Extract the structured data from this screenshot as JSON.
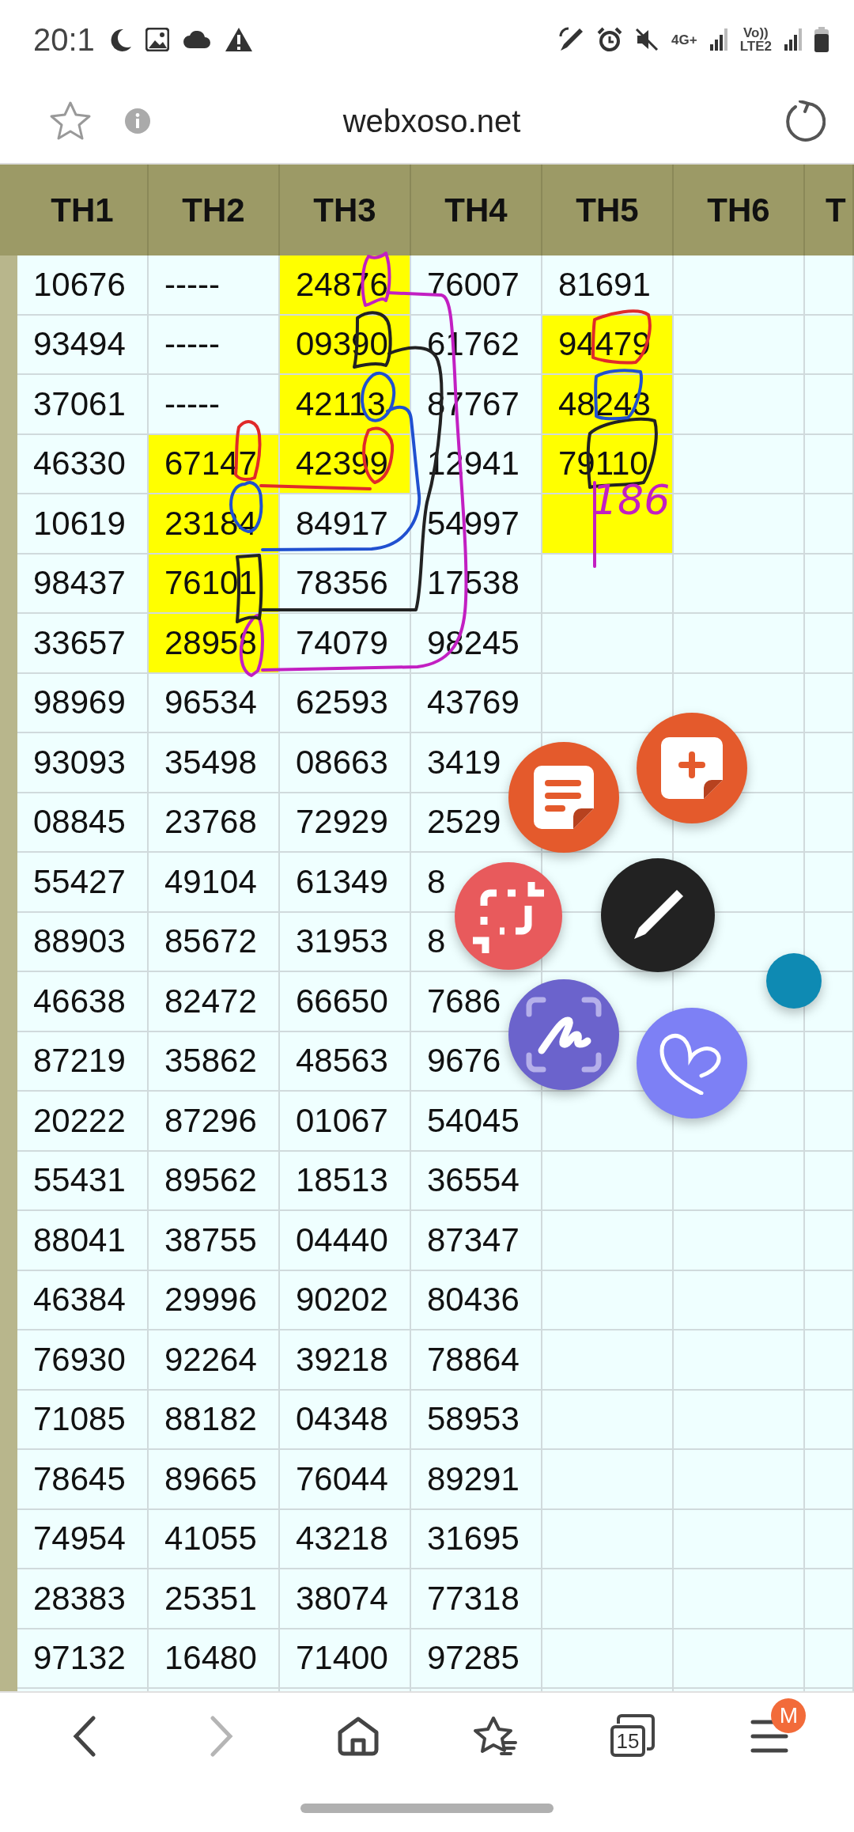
{
  "status_bar": {
    "time": "20:1",
    "network": "4G+",
    "volte": "Vo))",
    "lte": "LTE2"
  },
  "address_bar": {
    "url": "webxoso.net"
  },
  "table": {
    "columns": [
      "TH1",
      "TH2",
      "TH3",
      "TH4",
      "TH5",
      "TH6",
      "T"
    ],
    "rows": [
      {
        "cells": [
          "10676",
          "-----",
          "24876",
          "76007",
          "81691"
        ],
        "highlighted": [
          false,
          false,
          true,
          false,
          false,
          false,
          false
        ]
      },
      {
        "cells": [
          "93494",
          "-----",
          "09390",
          "61762",
          "94479"
        ],
        "highlighted": [
          false,
          false,
          true,
          false,
          true,
          false,
          false
        ]
      },
      {
        "cells": [
          "37061",
          "-----",
          "42113",
          "87767",
          "48243"
        ],
        "highlighted": [
          false,
          false,
          true,
          false,
          true,
          false,
          false
        ]
      },
      {
        "cells": [
          "46330",
          "67147",
          "42399",
          "12941",
          "79110"
        ],
        "highlighted": [
          false,
          true,
          true,
          false,
          true,
          false,
          false
        ]
      },
      {
        "cells": [
          "10619",
          "23184",
          "84917",
          "54997"
        ],
        "highlighted": [
          false,
          true,
          false,
          false,
          true,
          false,
          false
        ]
      },
      {
        "cells": [
          "98437",
          "76101",
          "78356",
          "17538"
        ],
        "highlighted": [
          false,
          true,
          false,
          false,
          false,
          false,
          false
        ]
      },
      {
        "cells": [
          "33657",
          "28958",
          "74079",
          "98245"
        ],
        "highlighted": [
          false,
          true,
          false,
          false,
          false,
          false,
          false
        ]
      },
      {
        "cells": [
          "98969",
          "96534",
          "62593",
          "43769"
        ],
        "highlighted": [
          false,
          false,
          false,
          false,
          false,
          false,
          false
        ]
      },
      {
        "cells": [
          "93093",
          "35498",
          "08663",
          "3419"
        ],
        "highlighted": [
          false,
          false,
          false,
          false,
          false,
          false,
          false
        ]
      },
      {
        "cells": [
          "08845",
          "23768",
          "72929",
          "2529"
        ],
        "highlighted": [
          false,
          false,
          false,
          false,
          false,
          false,
          false
        ]
      },
      {
        "cells": [
          "55427",
          "49104",
          "61349",
          "8"
        ],
        "highlighted": [
          false,
          false,
          false,
          false,
          false,
          false,
          false
        ]
      },
      {
        "cells": [
          "88903",
          "85672",
          "31953",
          "8"
        ],
        "highlighted": [
          false,
          false,
          false,
          false,
          false,
          false,
          false
        ]
      },
      {
        "cells": [
          "46638",
          "82472",
          "66650",
          "7686"
        ],
        "highlighted": [
          false,
          false,
          false,
          false,
          false,
          false,
          false
        ]
      },
      {
        "cells": [
          "87219",
          "35862",
          "48563",
          "9676"
        ],
        "highlighted": [
          false,
          false,
          false,
          false,
          false,
          false,
          false
        ]
      },
      {
        "cells": [
          "20222",
          "87296",
          "01067",
          "54045"
        ],
        "highlighted": [
          false,
          false,
          false,
          false,
          false,
          false,
          false
        ]
      },
      {
        "cells": [
          "55431",
          "89562",
          "18513",
          "36554"
        ],
        "highlighted": [
          false,
          false,
          false,
          false,
          false,
          false,
          false
        ]
      },
      {
        "cells": [
          "88041",
          "38755",
          "04440",
          "87347"
        ],
        "highlighted": [
          false,
          false,
          false,
          false,
          false,
          false,
          false
        ]
      },
      {
        "cells": [
          "46384",
          "29996",
          "90202",
          "80436"
        ],
        "highlighted": [
          false,
          false,
          false,
          false,
          false,
          false,
          false
        ]
      },
      {
        "cells": [
          "76930",
          "92264",
          "39218",
          "78864"
        ],
        "highlighted": [
          false,
          false,
          false,
          false,
          false,
          false,
          false
        ]
      },
      {
        "cells": [
          "71085",
          "88182",
          "04348",
          "58953"
        ],
        "highlighted": [
          false,
          false,
          false,
          false,
          false,
          false,
          false
        ]
      },
      {
        "cells": [
          "78645",
          "89665",
          "76044",
          "89291"
        ],
        "highlighted": [
          false,
          false,
          false,
          false,
          false,
          false,
          false
        ]
      },
      {
        "cells": [
          "74954",
          "41055",
          "43218",
          "31695"
        ],
        "highlighted": [
          false,
          false,
          false,
          false,
          false,
          false,
          false
        ]
      },
      {
        "cells": [
          "28383",
          "25351",
          "38074",
          "77318"
        ],
        "highlighted": [
          false,
          false,
          false,
          false,
          false,
          false,
          false
        ]
      },
      {
        "cells": [
          "97132",
          "16480",
          "71400",
          "97285"
        ],
        "highlighted": [
          false,
          false,
          false,
          false,
          false,
          false,
          false
        ]
      }
    ]
  },
  "annotation": {
    "note": "186"
  },
  "floating_menu": [
    {
      "kind": "notes"
    },
    {
      "kind": "new_note"
    },
    {
      "kind": "capture"
    },
    {
      "kind": "pen"
    },
    {
      "kind": "smart_select"
    },
    {
      "kind": "heart"
    },
    {
      "kind": "handle"
    }
  ],
  "bottom_nav": [
    {
      "kind": "back",
      "disabled": false
    },
    {
      "kind": "forward",
      "disabled": true
    },
    {
      "kind": "home",
      "disabled": false
    },
    {
      "kind": "bookmarks",
      "disabled": false
    },
    {
      "kind": "tabs",
      "disabled": false,
      "count": "15"
    },
    {
      "kind": "menu",
      "disabled": false,
      "badge": "M"
    }
  ]
}
